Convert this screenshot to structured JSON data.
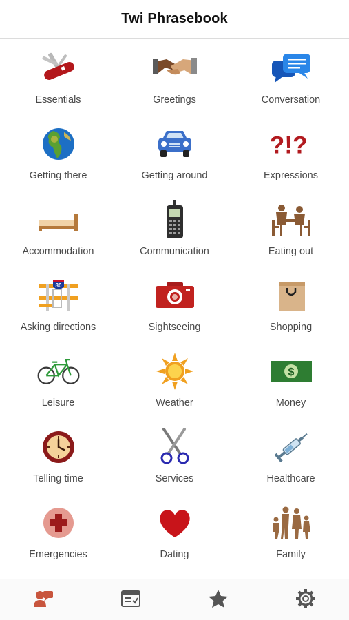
{
  "header": {
    "title": "Twi Phrasebook"
  },
  "categories": [
    {
      "label": "Essentials",
      "icon": "swiss-knife-icon"
    },
    {
      "label": "Greetings",
      "icon": "handshake-icon"
    },
    {
      "label": "Conversation",
      "icon": "speech-bubbles-icon"
    },
    {
      "label": "Getting there",
      "icon": "globe-icon"
    },
    {
      "label": "Getting around",
      "icon": "car-icon"
    },
    {
      "label": "Expressions",
      "icon": "question-exclamation-icon"
    },
    {
      "label": "Accommodation",
      "icon": "bed-icon"
    },
    {
      "label": "Communication",
      "icon": "mobile-phone-icon"
    },
    {
      "label": "Eating out",
      "icon": "dining-table-icon"
    },
    {
      "label": "Asking directions",
      "icon": "road-sign-icon"
    },
    {
      "label": "Sightseeing",
      "icon": "camera-icon"
    },
    {
      "label": "Shopping",
      "icon": "shopping-bag-icon"
    },
    {
      "label": "Leisure",
      "icon": "bicycle-icon"
    },
    {
      "label": "Weather",
      "icon": "sun-icon"
    },
    {
      "label": "Money",
      "icon": "dollar-bill-icon"
    },
    {
      "label": "Telling time",
      "icon": "clock-icon"
    },
    {
      "label": "Services",
      "icon": "scissors-icon"
    },
    {
      "label": "Healthcare",
      "icon": "syringe-icon"
    },
    {
      "label": "Emergencies",
      "icon": "first-aid-icon"
    },
    {
      "label": "Dating",
      "icon": "heart-icon"
    },
    {
      "label": "Family",
      "icon": "family-icon"
    }
  ],
  "highway_sign_text": "80",
  "tabbar": {
    "tabs": [
      {
        "icon": "phrasebook-icon",
        "active": true
      },
      {
        "icon": "flashcards-icon",
        "active": false
      },
      {
        "icon": "star-icon",
        "active": false
      },
      {
        "icon": "gear-icon",
        "active": false
      }
    ],
    "active_color": "#c8553d",
    "inactive_color": "#555555"
  }
}
